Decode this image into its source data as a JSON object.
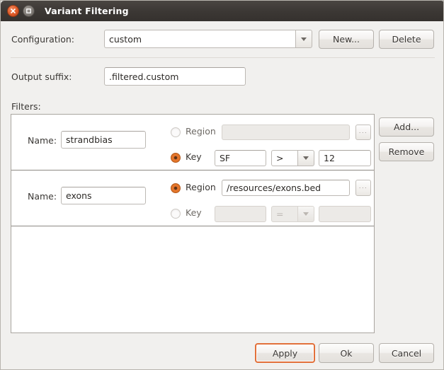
{
  "window": {
    "title": "Variant Filtering",
    "close_icon": "close-icon",
    "maximize_icon": "maximize-icon"
  },
  "configuration": {
    "label": "Configuration:",
    "value": "custom",
    "dropdown_icon": "chevron-down-icon",
    "new_button": "New...",
    "delete_button": "Delete"
  },
  "output_suffix": {
    "label": "Output suffix:",
    "value": ".filtered.custom"
  },
  "filters": {
    "label": "Filters:",
    "add_button": "Add...",
    "remove_button": "Remove",
    "name_label": "Name:",
    "region_label": "Region",
    "key_label": "Key",
    "browse_button": "...",
    "rows": [
      {
        "name": "strandbias",
        "mode": "key",
        "region_value": "",
        "region_enabled": false,
        "key_value": "SF",
        "key_operator": ">",
        "key_threshold": "12",
        "key_enabled": true
      },
      {
        "name": "exons",
        "mode": "region",
        "region_value": "/resources/exons.bed",
        "region_enabled": true,
        "key_value": "",
        "key_operator": "=",
        "key_threshold": "",
        "key_enabled": false
      }
    ]
  },
  "footer": {
    "apply_button": "Apply",
    "ok_button": "Ok",
    "cancel_button": "Cancel"
  },
  "colors": {
    "accent": "#e0762a",
    "titlebar": "#3c3835",
    "background": "#f1f0ee",
    "field_border": "#bdb9b4"
  }
}
